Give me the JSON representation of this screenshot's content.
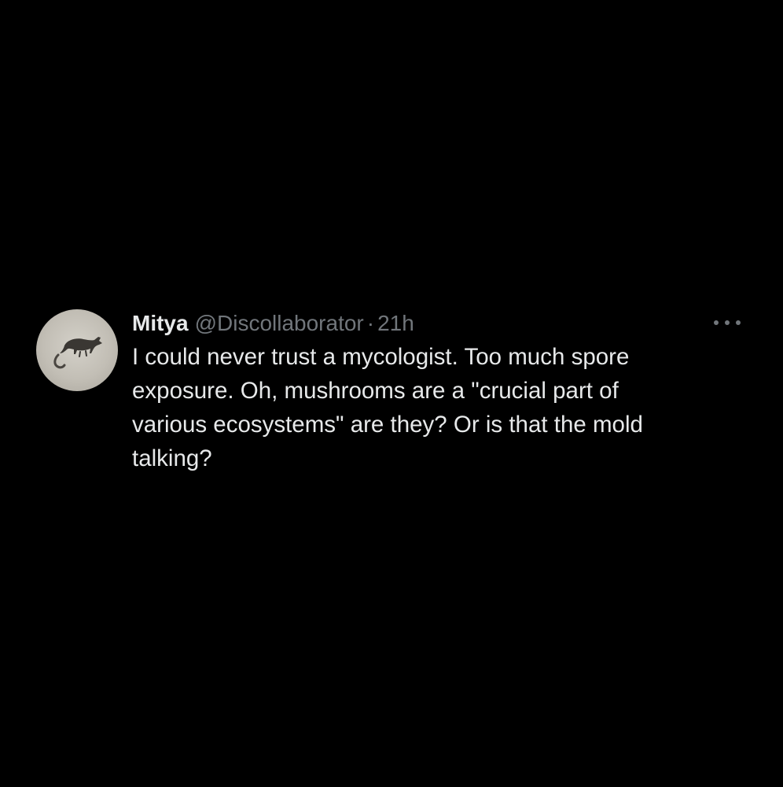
{
  "tweet": {
    "author_name": "Mitya",
    "author_handle": "@Discollaborator",
    "separator": "·",
    "timestamp": "21h",
    "text": "I could never trust a mycologist. Too much spore\nexposure. Oh, mushrooms are a \"crucial part of\nvarious ecosystems\" are they? Or is that the mold\ntalking?",
    "more_icon": "more-horizontal-icon",
    "avatar_icon": "animal-avatar"
  },
  "colors": {
    "background": "#000000",
    "primary_text": "#e7e9ea",
    "secondary_text": "#71767b"
  }
}
